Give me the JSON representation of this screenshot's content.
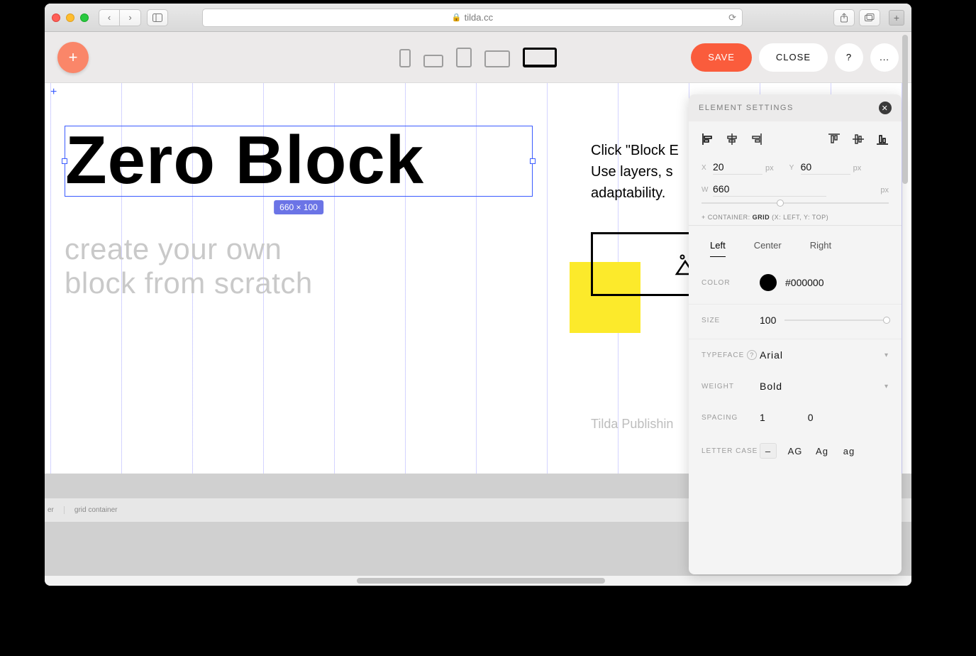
{
  "browser": {
    "url": "tilda.cc"
  },
  "toolbar": {
    "save_label": "SAVE",
    "close_label": "CLOSE",
    "help_label": "?",
    "more_label": "..."
  },
  "canvas": {
    "headline": "Zero Block",
    "selection_badge": "660 × 100",
    "subline_line1": "create your own",
    "subline_line2": "block from scratch",
    "paragraph_line1": "Click \"Block E",
    "paragraph_line2": "Use layers, s",
    "paragraph_line3": "adaptability. ",
    "footer": "Tilda Publishin"
  },
  "bottom_strip": {
    "item1": "er",
    "item2": "grid container"
  },
  "panel": {
    "title": "ELEMENT SETTINGS",
    "position": {
      "x_label": "X",
      "x_value": "20",
      "x_unit": "px",
      "y_label": "Y",
      "y_value": "60",
      "y_unit": "px",
      "w_label": "W",
      "w_value": "660",
      "w_unit": "px",
      "container_note_prefix": "+ CONTAINER: ",
      "container_note_value": "GRID",
      "container_note_axes": " (X: LEFT, Y: TOP)"
    },
    "align_tabs": {
      "left": "Left",
      "center": "Center",
      "right": "Right"
    },
    "props": {
      "color_label": "COLOR",
      "color_value": "#000000",
      "size_label": "SIZE",
      "size_value": "100",
      "typeface_label": "TYPEFACE",
      "typeface_value": "Arial",
      "weight_label": "WEIGHT",
      "weight_value": "Bold",
      "spacing_label": "SPACING",
      "spacing_v1": "1",
      "spacing_v2": "0",
      "lettercase_label": "LETTER CASE",
      "lc_dash": "–",
      "lc_upper": "AG",
      "lc_title": "Ag",
      "lc_lower": "ag"
    }
  }
}
